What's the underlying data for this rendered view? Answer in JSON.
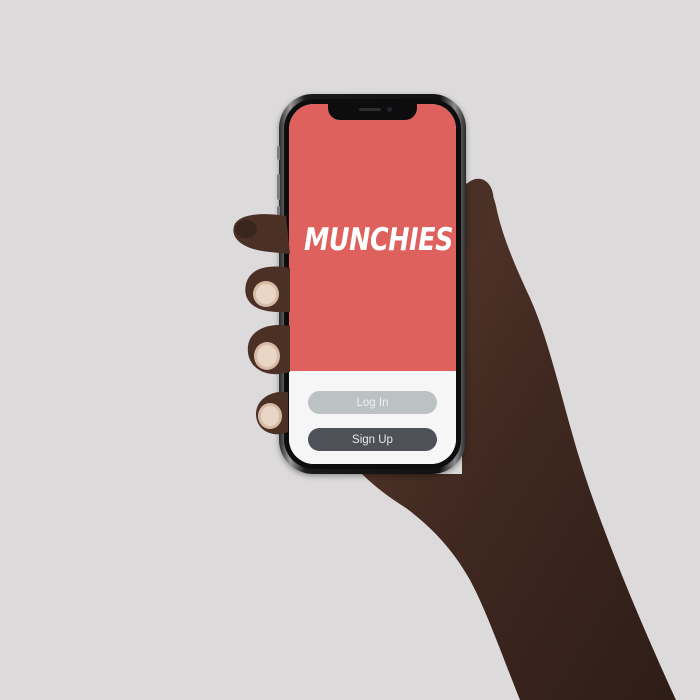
{
  "app": {
    "logo_text": "MUNCHIES"
  },
  "auth": {
    "login_label": "Log In",
    "signup_label": "Sign Up"
  },
  "colors": {
    "background": "#dcdadb",
    "hero": "#de615d",
    "login_button": "#bcc2c4",
    "signup_button": "#4f5159",
    "screen_bottom": "#f6f6f6"
  }
}
